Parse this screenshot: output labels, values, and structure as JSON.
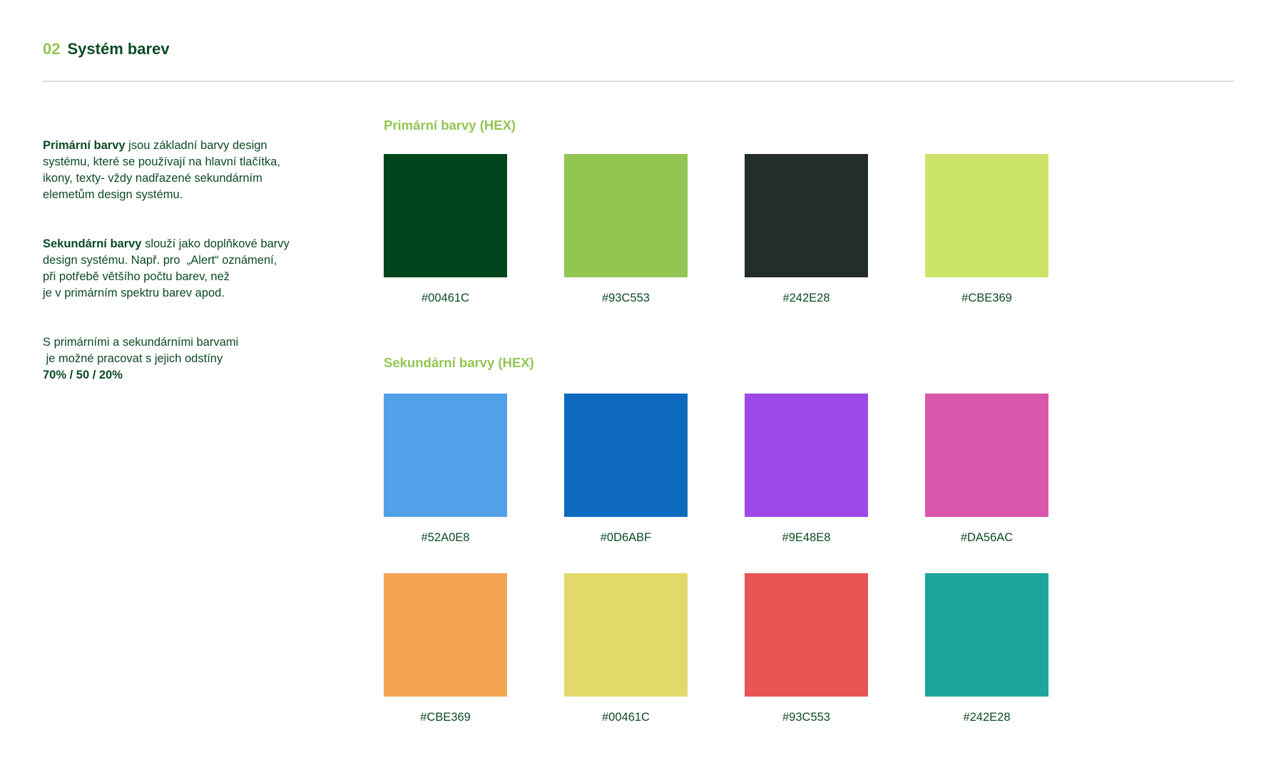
{
  "header": {
    "number": "02",
    "title": "Systém barev"
  },
  "intro": {
    "p1": {
      "bold": "Primární barvy",
      "rest_line1": " jsou základní barvy design",
      "line2": "systému, které se používají na hlavní tlačítka,",
      "line3": "ikony, texty- vždy nadřazené sekundárním",
      "line4": "elemetům design systému."
    },
    "p2": {
      "bold": "Sekundární barvy",
      "rest_line1": " slouží jako doplňkové barvy",
      "line2": "design systému. Např. pro  „Alert“ oznámení,",
      "line3": "při potřebě většího počtu barev, než",
      "line4": "je v primárním spektru barev apod."
    },
    "p3": {
      "line1": "S primárními a sekundárními barvami",
      "line2": " je možné pracovat s jejich odstíny",
      "bold_line3": "70% / 50 / 20%"
    }
  },
  "primary": {
    "label": "Primární barvy (HEX)",
    "swatches": [
      {
        "color": "#00461C",
        "hex": "#00461C"
      },
      {
        "color": "#93C553",
        "hex": "#93C553"
      },
      {
        "color": "#242E28",
        "hex": "#242E28"
      },
      {
        "color": "#CBE369",
        "hex": "#CBE369"
      }
    ]
  },
  "secondary": {
    "label": "Sekundární barvy (HEX)",
    "swatches": [
      {
        "color": "#52A0E8",
        "hex": "#52A0E8"
      },
      {
        "color": "#0D6ABF",
        "hex": "#0D6ABF"
      },
      {
        "color": "#9E48E8",
        "hex": "#9E48E8"
      },
      {
        "color": "#DA56AC",
        "hex": "#DA56AC"
      },
      {
        "color": "#F3A553",
        "hex": "#CBE369"
      },
      {
        "color": "#E2D96B",
        "hex": "#00461C"
      },
      {
        "color": "#E85454",
        "hex": "#93C553"
      },
      {
        "color": "#1EA59C",
        "hex": "#242E28"
      }
    ]
  }
}
